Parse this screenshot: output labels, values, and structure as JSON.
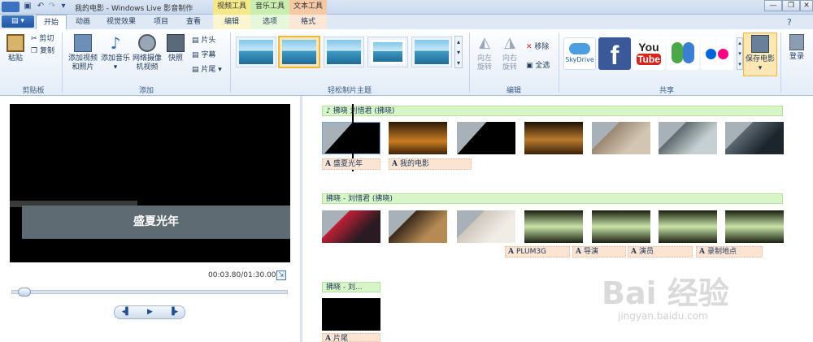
{
  "window": {
    "title": "我的电影 - Windows Live 影音制作"
  },
  "context_groups": [
    {
      "group": "视频工具",
      "tab": "编辑",
      "color": "#f4e98a"
    },
    {
      "group": "音乐工具",
      "tab": "选项",
      "color": "#c9eeb0"
    },
    {
      "group": "文本工具",
      "tab": "格式",
      "color": "#f6c9a6"
    }
  ],
  "tabs": [
    "开始",
    "动画",
    "视觉效果",
    "项目",
    "查看"
  ],
  "ribbon": {
    "clipboard": {
      "paste": "粘贴",
      "cut": "剪切",
      "copy": "复制",
      "label": "剪贴板"
    },
    "add": {
      "videos": "添加视频和照片",
      "music": "添加音乐",
      "webcam": "网络摄像机视频",
      "snapshot": "快照",
      "title": "片头",
      "caption": "字幕",
      "credits": "片尾",
      "label": "添加"
    },
    "themes": {
      "label": "轻松制片主题"
    },
    "edit": {
      "rotate_left": "向左旋转",
      "rotate_right": "向右旋转",
      "remove": "移除",
      "select_all": "全选",
      "label": "编辑"
    },
    "share": {
      "skydrive": "SkyDrive",
      "youtube_top": "You",
      "youtube_bottom": "Tube",
      "save_movie": "保存电影",
      "label": "共享"
    },
    "signin": "登录"
  },
  "preview": {
    "caption": "盛夏光年",
    "timecode": "00:03.80/01:30.00"
  },
  "storyboard": {
    "row1": {
      "music_icon": "♪",
      "music_text": "拂晓 刘惜君 (拂晓)",
      "captions": [
        "盛夏光年",
        "我的电影"
      ]
    },
    "row2": {
      "music_text": "拂晓 - 刘惜君 (拂晓)",
      "captions": [
        "PLUM3G",
        "导演",
        "演员",
        "录制地点"
      ]
    },
    "row3": {
      "music_text": "拂晓 - 刘...",
      "captions": [
        "片尾"
      ]
    }
  },
  "watermark": {
    "text": "Bai 经验",
    "url": "jingyan.baidu.com"
  },
  "colors": {
    "accent": "#1f56a3",
    "caption_bg": "#fbe4d2",
    "music_bg": "#d7f5c6"
  }
}
